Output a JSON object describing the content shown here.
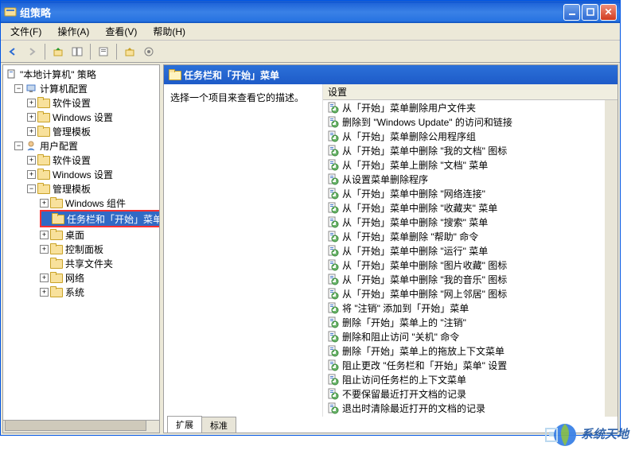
{
  "window": {
    "title": "组策略"
  },
  "menus": {
    "file": "文件(F)",
    "action": "操作(A)",
    "view": "查看(V)",
    "help": "帮助(H)"
  },
  "tree": {
    "root": "\"本地计算机\" 策略",
    "computer_config": "计算机配置",
    "user_config": "用户配置",
    "software": "软件设置",
    "windows": "Windows 设置",
    "admin": "管理模板",
    "win_components": "Windows 组件",
    "taskbar_start": "任务栏和「开始」菜单",
    "desktop": "桌面",
    "control_panel": "控制面板",
    "shared_folders": "共享文件夹",
    "network": "网络",
    "system": "系统"
  },
  "right": {
    "header_title": "任务栏和「开始」菜单",
    "desc": "选择一个项目来查看它的描述。",
    "col_setting": "设置",
    "items": [
      "从「开始」菜单删除用户文件夹",
      "删除到 \"Windows Update\" 的访问和链接",
      "从「开始」菜单删除公用程序组",
      "从「开始」菜单中删除 \"我的文档\" 图标",
      "从「开始」菜单上删除 \"文档\" 菜单",
      "从设置菜单删除程序",
      "从「开始」菜单中删除 \"网络连接\"",
      "从「开始」菜单中删除 \"收藏夹\" 菜单",
      "从「开始」菜单中删除 \"搜索\" 菜单",
      "从「开始」菜单删除 \"帮助\" 命令",
      "从「开始」菜单中删除 \"运行\" 菜单",
      "从「开始」菜单中删除 \"图片收藏\" 图标",
      "从「开始」菜单中删除 \"我的音乐\" 图标",
      "从「开始」菜单中删除 \"网上邻居\" 图标",
      "将 \"注销\" 添加到「开始」菜单",
      "删除「开始」菜单上的 \"注销\"",
      "删除和阻止访问 \"关机\" 命令",
      "删除「开始」菜单上的拖放上下文菜单",
      "阻止更改 \"任务栏和「开始」菜单\" 设置",
      "阻止访问任务栏的上下文菜单",
      "不要保留最近打开文档的记录",
      "退出时清除最近打开的文档的记录"
    ],
    "tab_extended": "扩展",
    "tab_standard": "标准"
  },
  "watermark": "系统天地"
}
